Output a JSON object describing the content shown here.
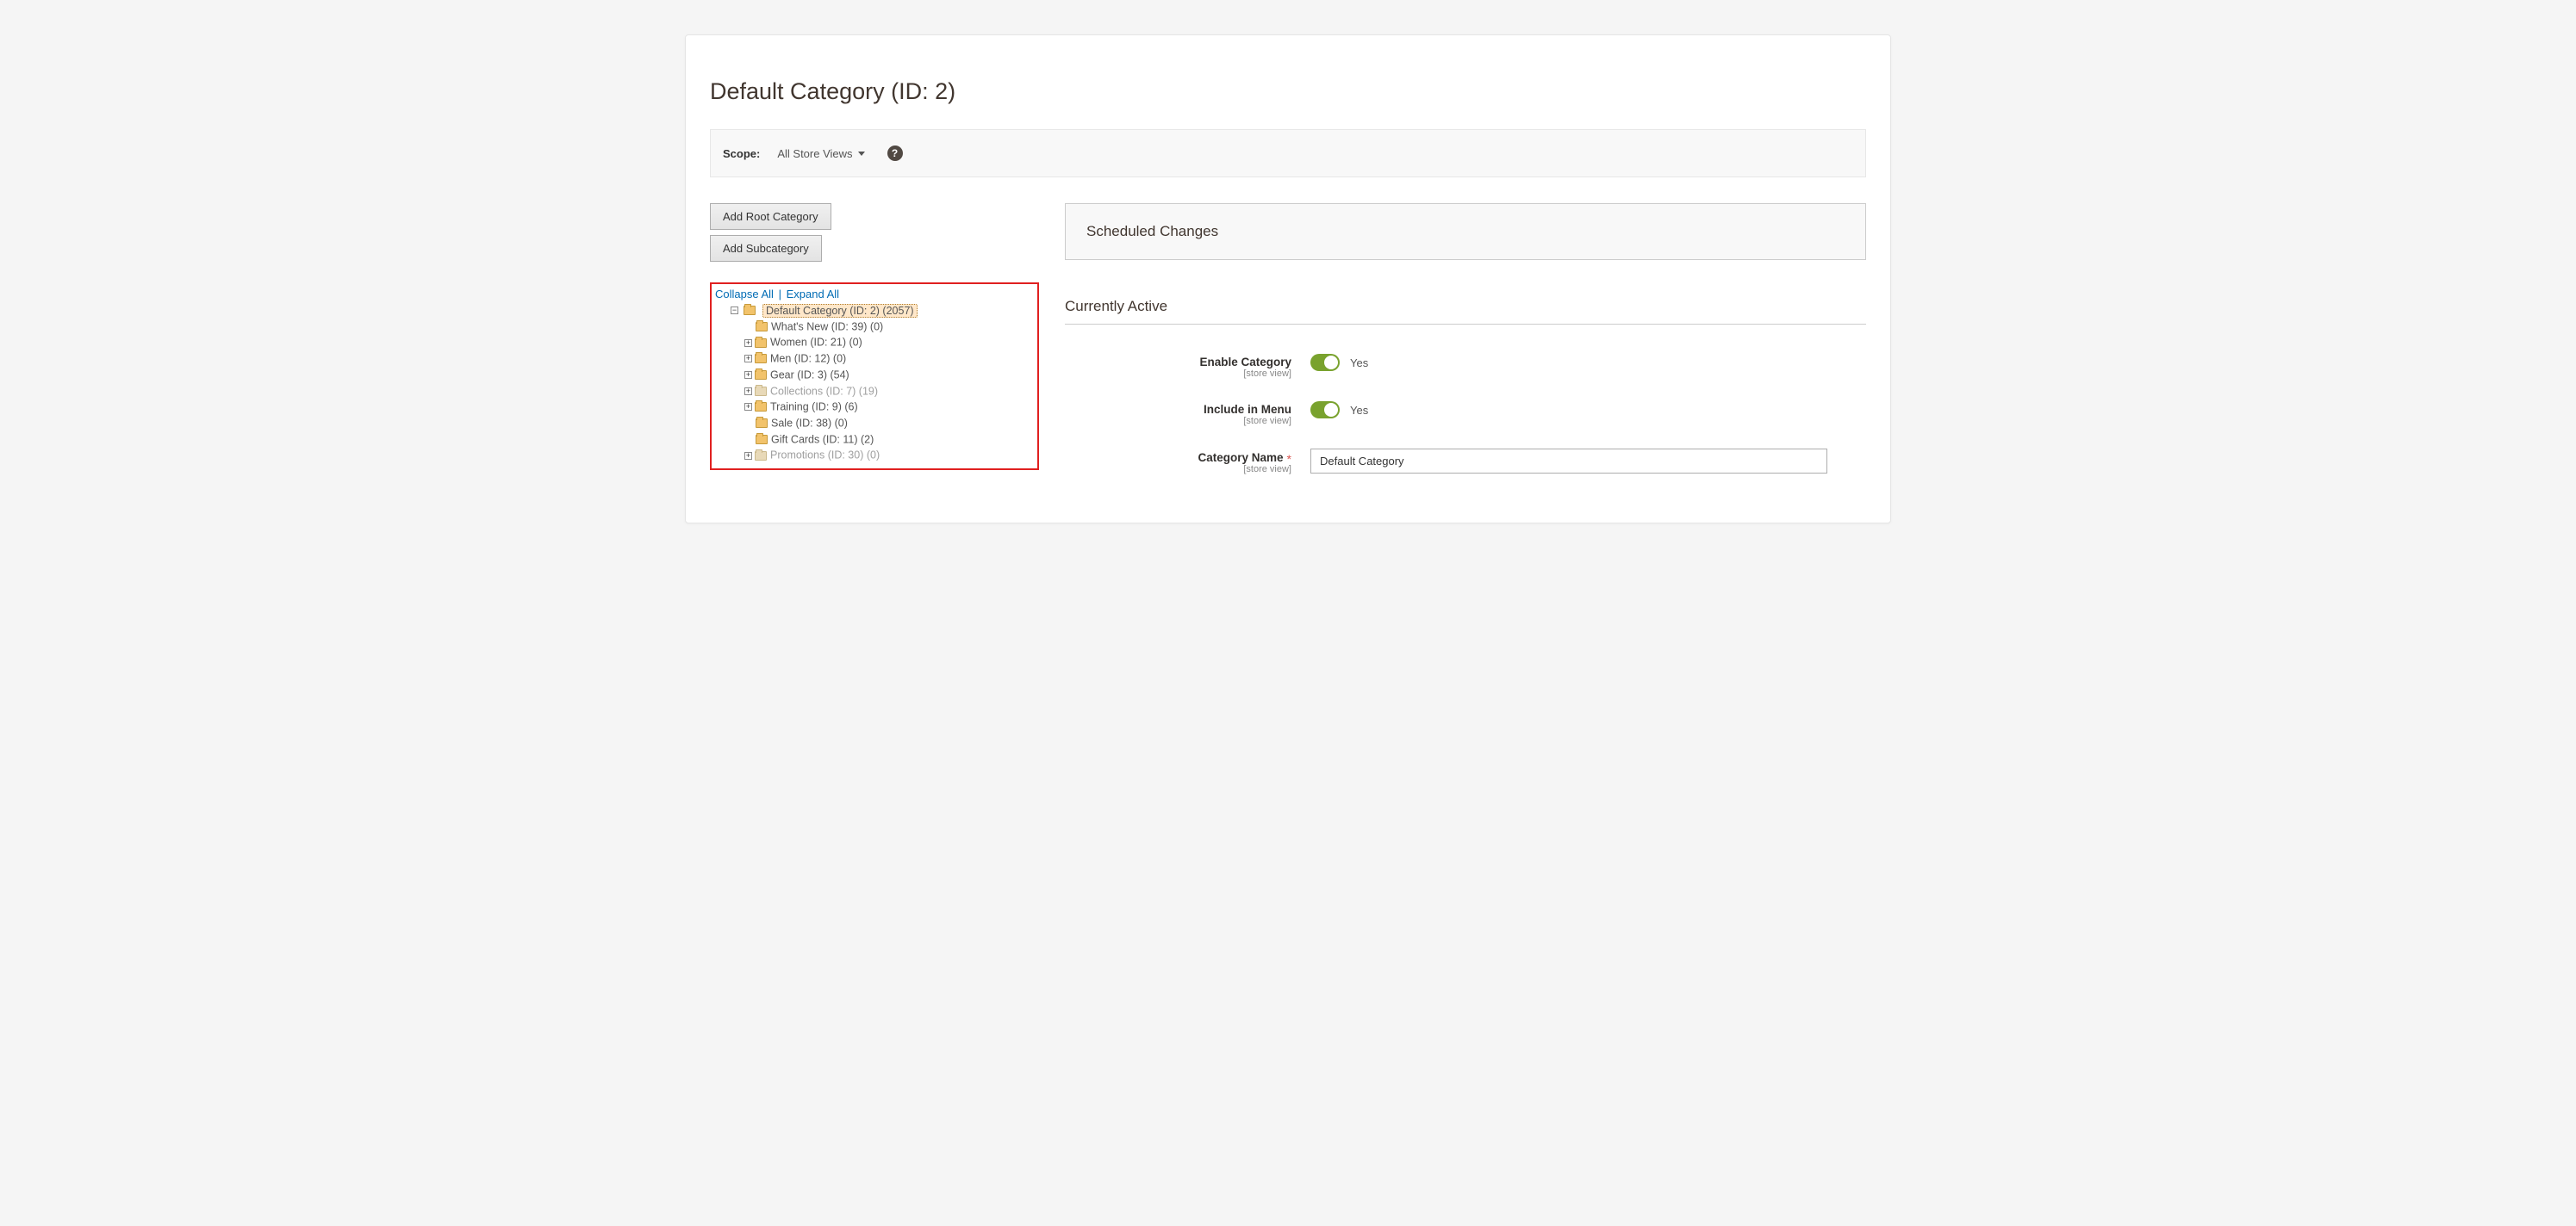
{
  "page": {
    "title": "Default Category (ID: 2)"
  },
  "scope": {
    "label": "Scope:",
    "selected": "All Store Views"
  },
  "sidebar": {
    "add_root_label": "Add Root Category",
    "add_sub_label": "Add Subcategory",
    "collapse_label": "Collapse All",
    "separator": "|",
    "expand_label": "Expand All"
  },
  "tree": {
    "root": {
      "label": "Default Category (ID: 2) (2057)"
    },
    "children": [
      {
        "label": "What's New (ID: 39) (0)",
        "expandable": false,
        "dim": false
      },
      {
        "label": "Women (ID: 21) (0)",
        "expandable": true,
        "dim": false
      },
      {
        "label": "Men (ID: 12) (0)",
        "expandable": true,
        "dim": false
      },
      {
        "label": "Gear (ID: 3) (54)",
        "expandable": true,
        "dim": false
      },
      {
        "label": "Collections (ID: 7) (19)",
        "expandable": true,
        "dim": true
      },
      {
        "label": "Training (ID: 9) (6)",
        "expandable": true,
        "dim": false
      },
      {
        "label": "Sale (ID: 38) (0)",
        "expandable": false,
        "dim": false
      },
      {
        "label": "Gift Cards (ID: 11) (2)",
        "expandable": false,
        "dim": false
      },
      {
        "label": "Promotions (ID: 30) (0)",
        "expandable": true,
        "dim": true
      }
    ]
  },
  "main": {
    "scheduled_changes_title": "Scheduled Changes",
    "currently_active_title": "Currently Active",
    "fields": {
      "enable_category": {
        "label": "Enable Category",
        "scope": "[store view]",
        "value_text": "Yes"
      },
      "include_in_menu": {
        "label": "Include in Menu",
        "scope": "[store view]",
        "value_text": "Yes"
      },
      "category_name": {
        "label": "Category Name",
        "scope": "[store view]",
        "value": "Default Category"
      }
    }
  },
  "glyphs": {
    "plus": "+",
    "minus": "−",
    "question": "?"
  }
}
